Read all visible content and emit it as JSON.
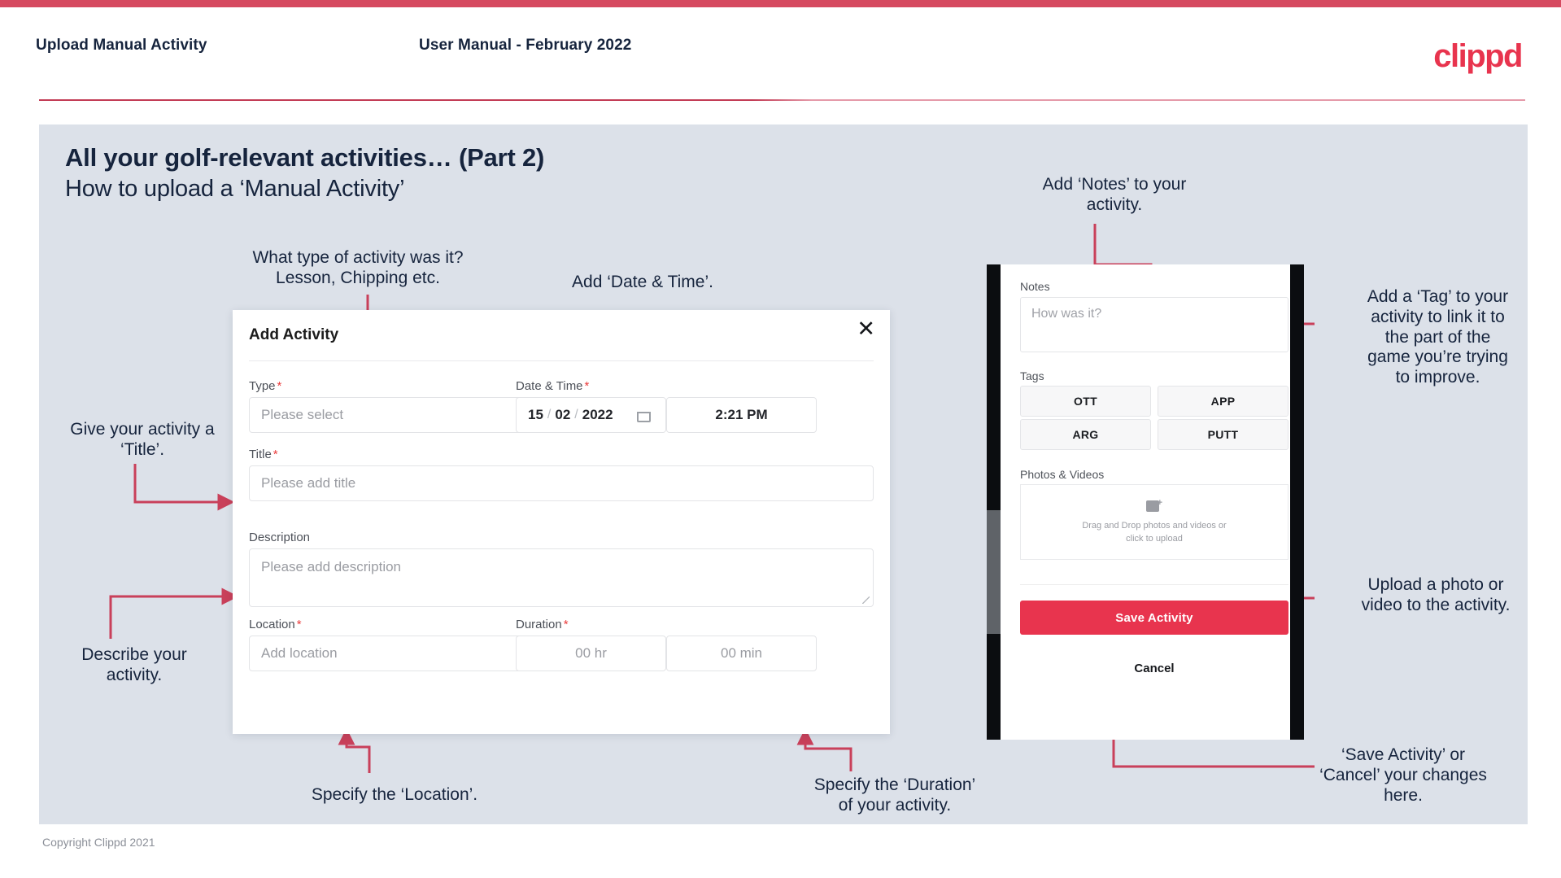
{
  "header": {
    "left_title": "Upload Manual Activity",
    "center_title": "User Manual - February 2022",
    "logo": "clippd"
  },
  "slide": {
    "title_line1": "All your golf-relevant activities… (Part 2)",
    "title_line2": "How to upload a ‘Manual Activity’",
    "copyright": "Copyright Clippd 2021"
  },
  "modal": {
    "title": "Add Activity",
    "close_icon": "close-icon",
    "fields": {
      "type_label": "Type",
      "type_placeholder": "Please select",
      "datetime_label": "Date & Time",
      "date_day": "15",
      "date_month": "02",
      "date_year": "2022",
      "time_value": "2:21 PM",
      "title_label": "Title",
      "title_placeholder": "Please add title",
      "description_label": "Description",
      "description_placeholder": "Please add description",
      "location_label": "Location",
      "location_placeholder": "Add location",
      "duration_label": "Duration",
      "duration_hours_placeholder": "00 hr",
      "duration_minutes_placeholder": "00 min",
      "required_marker": "*"
    }
  },
  "phone": {
    "notes_label": "Notes",
    "notes_placeholder": "How was it?",
    "tags_label": "Tags",
    "tags": [
      "OTT",
      "APP",
      "ARG",
      "PUTT"
    ],
    "photos_label": "Photos & Videos",
    "dropzone_text": "Drag and Drop photos and videos or\nclick to upload",
    "dropzone_icon": "image-add-icon",
    "save_label": "Save Activity",
    "cancel_label": "Cancel"
  },
  "annotations": {
    "type": "What type of activity was it?\nLesson, Chipping etc.",
    "datetime": "Add ‘Date & Time’.",
    "title": "Give your activity a\n‘Title’.",
    "description": "Describe your\nactivity.",
    "location": "Specify the ‘Location’.",
    "duration": "Specify the ‘Duration’\nof your activity.",
    "notes": "Add ‘Notes’ to your\nactivity.",
    "tags": "Add a ‘Tag’ to your\nactivity to link it to\nthe part of the\ngame you’re trying\nto improve.",
    "photos": "Upload a photo or\nvideo to the activity.",
    "save_cancel": "‘Save Activity’ or\n‘Cancel’ your changes\nhere."
  },
  "colors": {
    "brand_red": "#e8344e",
    "top_bar": "#d64a60",
    "arrow": "#c9405a",
    "slide_bg": "#dce1e9",
    "text_dark": "#16243d"
  }
}
